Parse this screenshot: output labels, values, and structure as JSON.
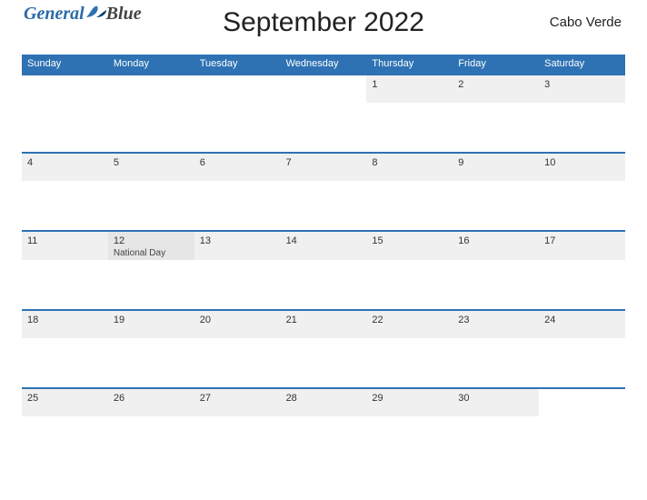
{
  "logo": {
    "part1": "General",
    "part2": "Blue"
  },
  "title": "September 2022",
  "region": "Cabo Verde",
  "dow": [
    "Sunday",
    "Monday",
    "Tuesday",
    "Wednesday",
    "Thursday",
    "Friday",
    "Saturday"
  ],
  "weeks": [
    [
      {
        "n": ""
      },
      {
        "n": ""
      },
      {
        "n": ""
      },
      {
        "n": ""
      },
      {
        "n": "1"
      },
      {
        "n": "2"
      },
      {
        "n": "3"
      }
    ],
    [
      {
        "n": "4"
      },
      {
        "n": "5"
      },
      {
        "n": "6"
      },
      {
        "n": "7"
      },
      {
        "n": "8"
      },
      {
        "n": "9"
      },
      {
        "n": "10"
      }
    ],
    [
      {
        "n": "11"
      },
      {
        "n": "12",
        "label": "National Day"
      },
      {
        "n": "13"
      },
      {
        "n": "14"
      },
      {
        "n": "15"
      },
      {
        "n": "16"
      },
      {
        "n": "17"
      }
    ],
    [
      {
        "n": "18"
      },
      {
        "n": "19"
      },
      {
        "n": "20"
      },
      {
        "n": "21"
      },
      {
        "n": "22"
      },
      {
        "n": "23"
      },
      {
        "n": "24"
      }
    ],
    [
      {
        "n": "25"
      },
      {
        "n": "26"
      },
      {
        "n": "27"
      },
      {
        "n": "28"
      },
      {
        "n": "29"
      },
      {
        "n": "30"
      },
      {
        "n": ""
      }
    ]
  ]
}
